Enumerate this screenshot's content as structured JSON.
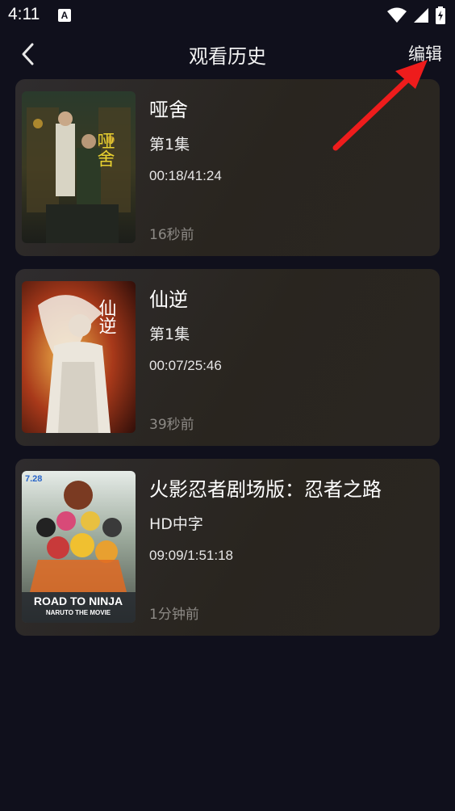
{
  "status_bar": {
    "time": "4:11",
    "notification_letter": "A",
    "icons": [
      "wifi-icon",
      "signal-icon",
      "battery-charging-icon"
    ]
  },
  "header": {
    "back_icon": "chevron-left-icon",
    "title": "观看历史",
    "edit_label": "编辑"
  },
  "history": [
    {
      "title": "哑舍",
      "episode": "第1集",
      "progress": "00:18/41:24",
      "watched_ago": "16秒前",
      "poster_text": "哑舍"
    },
    {
      "title": "仙逆",
      "episode": "第1集",
      "progress": "00:07/25:46",
      "watched_ago": "39秒前",
      "poster_text": "仙逆"
    },
    {
      "title": "火影忍者剧场版：忍者之路",
      "episode": "HD中字",
      "progress": "09:09/1:51:18",
      "watched_ago": "1分钟前",
      "poster_text": "ROAD TO NINJA",
      "poster_subtext": "NARUTO THE MOVIE",
      "poster_date": "7.28"
    }
  ],
  "colors": {
    "background": "#10101c",
    "card": "#2c2926",
    "annotation_arrow": "#ee1c1c"
  }
}
